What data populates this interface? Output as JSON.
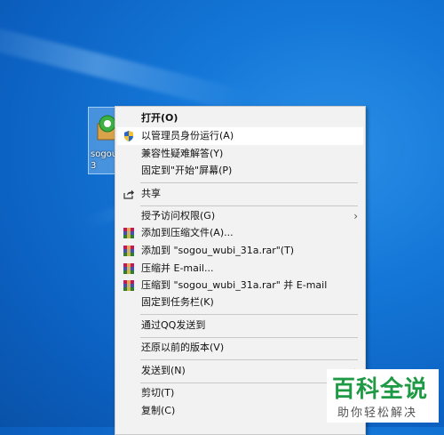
{
  "desktop": {
    "icon_label": "sogou_\n3"
  },
  "menu": {
    "items": [
      {
        "label": "打开(O)",
        "bold": true,
        "icon": null
      },
      {
        "label": "以管理员身份运行(A)",
        "icon": "uac-shield-icon",
        "highlighted": true
      },
      {
        "label": "兼容性疑难解答(Y)",
        "icon": null
      },
      {
        "label": "固定到\"开始\"屏幕(P)",
        "icon": null
      },
      {
        "label": "共享",
        "icon": "share-icon"
      },
      {
        "label": "授予访问权限(G)",
        "icon": null,
        "submenu": true
      },
      {
        "label": "添加到压缩文件(A)...",
        "icon": "winrar-icon"
      },
      {
        "label": "添加到 \"sogou_wubi_31a.rar\"(T)",
        "icon": "winrar-icon"
      },
      {
        "label": "压缩并 E-mail...",
        "icon": "winrar-icon"
      },
      {
        "label": "压缩到 \"sogou_wubi_31a.rar\" 并 E-mail",
        "icon": "winrar-icon"
      },
      {
        "label": "固定到任务栏(K)",
        "icon": null
      },
      {
        "label": "通过QQ发送到",
        "icon": null
      },
      {
        "label": "还原以前的版本(V)",
        "icon": null
      },
      {
        "label": "发送到(N)",
        "icon": null,
        "submenu": true
      },
      {
        "label": "剪切(T)",
        "icon": null
      },
      {
        "label": "复制(C)",
        "icon": null
      }
    ],
    "submenu_arrow": "›"
  },
  "watermark": {
    "title": "百科全说",
    "subtitle": "助你轻松解决"
  },
  "colors": {
    "desktop_bg": "#1477d8",
    "menu_bg": "#f2f2f2",
    "highlight": "#ffffff",
    "watermark_green": "#1f9a44"
  }
}
